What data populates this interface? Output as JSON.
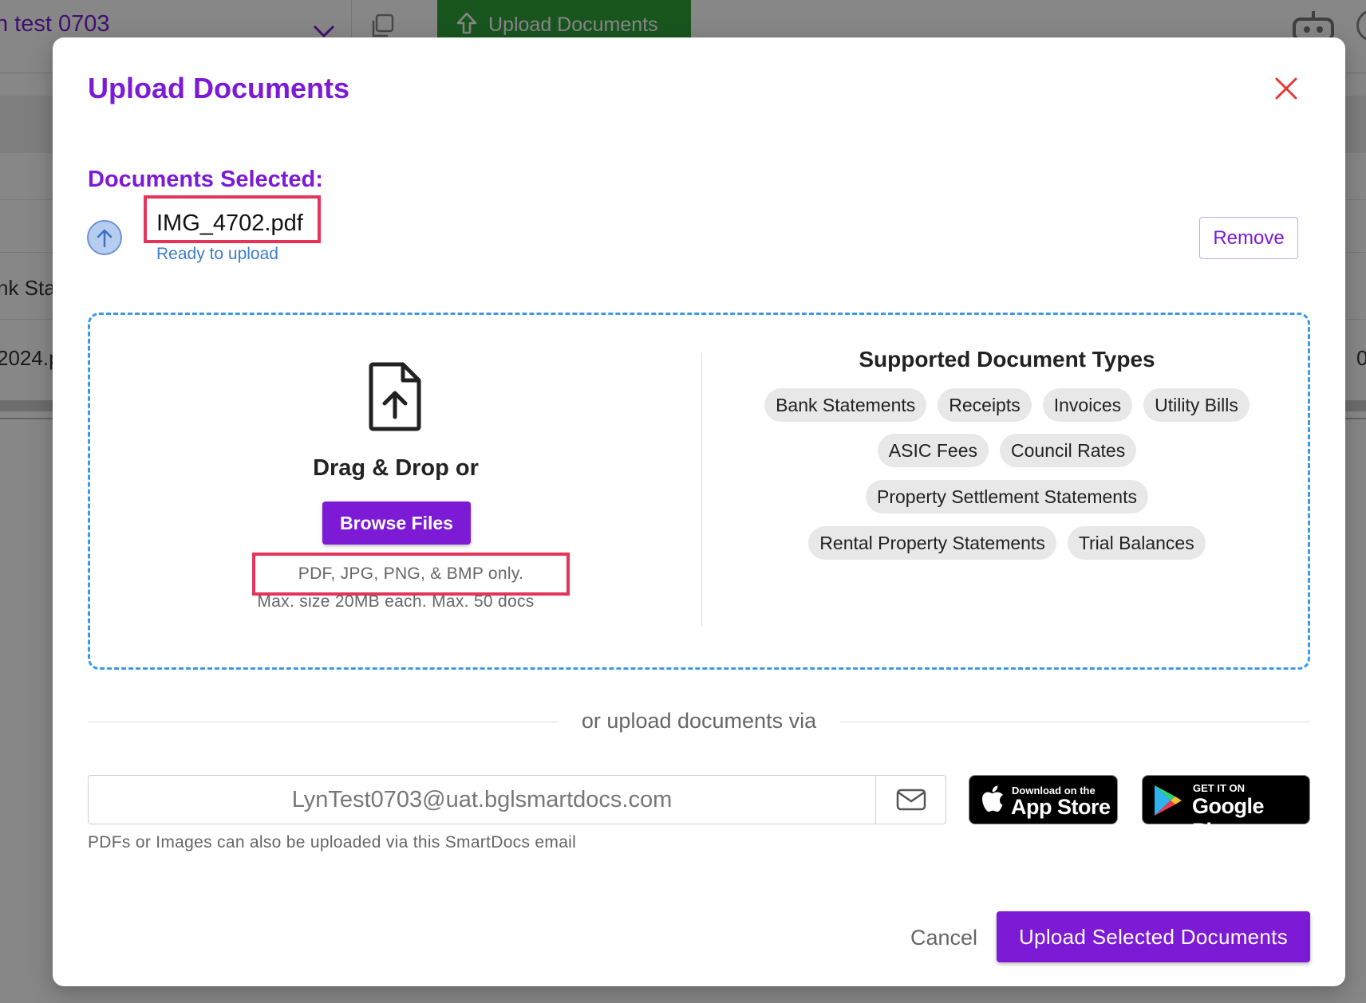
{
  "background": {
    "project_label": "n test 0703",
    "upload_button": "Upload Documents",
    "row_text_1": "nk Sta",
    "row_text_2": "2024.p",
    "row_text_3": "0"
  },
  "modal": {
    "title": "Upload Documents",
    "selected_label": "Documents Selected:",
    "file": {
      "name": "IMG_4702.pdf",
      "status": "Ready to upload"
    },
    "remove_label": "Remove",
    "dropzone": {
      "drag_text": "Drag & Drop or",
      "browse_label": "Browse Files",
      "formats": "PDF, JPG, PNG, & BMP only.",
      "limits": "Max. size 20MB each. Max. 50 docs"
    },
    "supported": {
      "title": "Supported Document Types",
      "types": [
        "Bank Statements",
        "Receipts",
        "Invoices",
        "Utility Bills",
        "ASIC Fees",
        "Council Rates",
        "Property Settlement Statements",
        "Rental Property Statements",
        "Trial Balances"
      ]
    },
    "via_text": "or upload documents via",
    "email": {
      "address": "LynTest0703@uat.bglsmartdocs.com",
      "hint": "PDFs or Images can also be uploaded via this SmartDocs email"
    },
    "app_store": {
      "small": "Download on the",
      "big": "App Store"
    },
    "google_play": {
      "small": "GET IT ON",
      "big": "Google Play"
    },
    "cancel_label": "Cancel",
    "upload_label": "Upload Selected Documents"
  },
  "colors": {
    "accent": "#7c1ad6",
    "highlight": "#e5345a",
    "dropzone_border": "#3b9ae8",
    "close": "#e53935",
    "bg_upload": "#2ea23a"
  },
  "icons": [
    "chevron-down-icon",
    "copy-icon",
    "upload-arrow-icon",
    "robot-icon",
    "close-icon",
    "upload-circle-icon",
    "file-upload-icon",
    "mail-icon",
    "apple-icon",
    "google-play-icon"
  ]
}
